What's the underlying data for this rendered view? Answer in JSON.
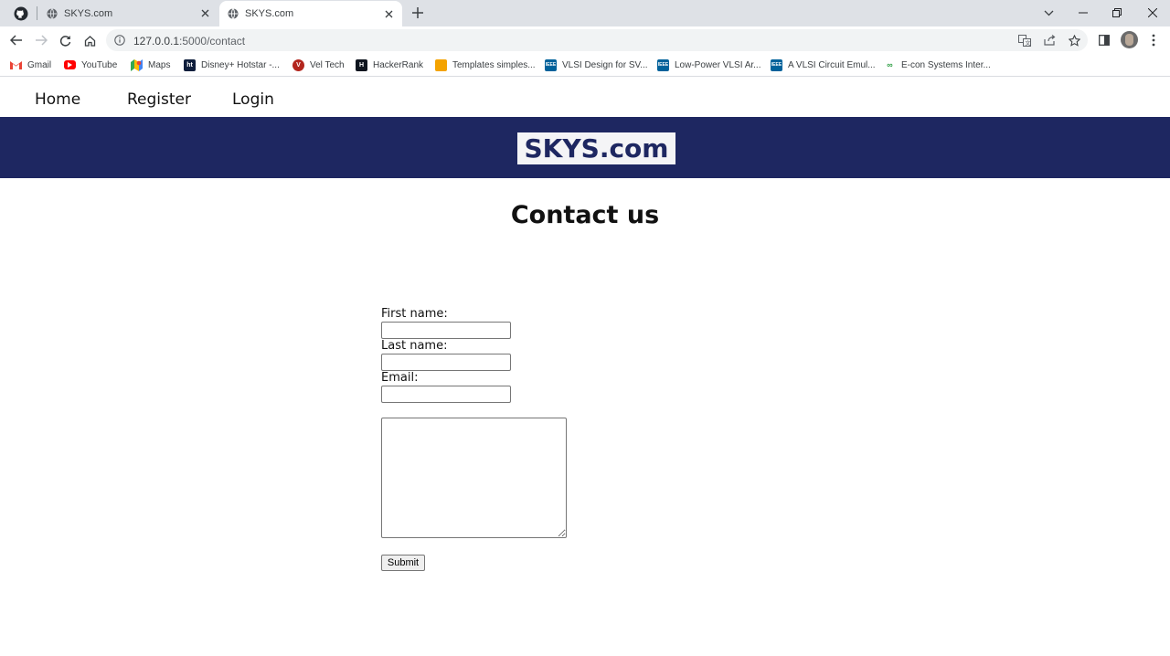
{
  "browser": {
    "tabs": [
      {
        "title": "SKYS.com",
        "active": false
      },
      {
        "title": "SKYS.com",
        "active": true
      }
    ],
    "url_host": "127.0.0.1",
    "url_path": ":5000/contact",
    "bookmarks": [
      {
        "label": "Gmail",
        "icon": "gmail-icon",
        "color": "#ea4335"
      },
      {
        "label": "YouTube",
        "icon": "youtube-icon",
        "color": "#ff0000"
      },
      {
        "label": "Maps",
        "icon": "maps-icon",
        "color": "#34a853"
      },
      {
        "label": "Disney+ Hotstar -...",
        "icon": "hotstar-icon",
        "color": "#0f1e3c"
      },
      {
        "label": "Vel Tech",
        "icon": "veltech-icon",
        "color": "#b3261e"
      },
      {
        "label": "HackerRank",
        "icon": "hackerrank-icon",
        "color": "#0e141e"
      },
      {
        "label": "Templates simples...",
        "icon": "templates-icon",
        "color": "#f4a300"
      },
      {
        "label": "VLSI Design for SV...",
        "icon": "ieee-icon",
        "color": "#00629b"
      },
      {
        "label": "Low-Power VLSI Ar...",
        "icon": "ieee-icon",
        "color": "#00629b"
      },
      {
        "label": "A VLSI Circuit Emul...",
        "icon": "ieee-icon",
        "color": "#00629b"
      },
      {
        "label": "E-con Systems Inter...",
        "icon": "econ-icon",
        "color": "#2e9e44"
      }
    ]
  },
  "site": {
    "nav": {
      "home": "Home",
      "register": "Register",
      "login": "Login"
    },
    "brand": "SKYS.com",
    "heading": "Contact us"
  },
  "form": {
    "first_name_label": "First name:",
    "first_name_value": "",
    "last_name_label": "Last name:",
    "last_name_value": "",
    "email_label": "Email:",
    "email_value": "",
    "message_value": "",
    "submit_label": "Submit"
  },
  "colors": {
    "banner": "#1e2761",
    "brand_text": "#1e2761"
  }
}
